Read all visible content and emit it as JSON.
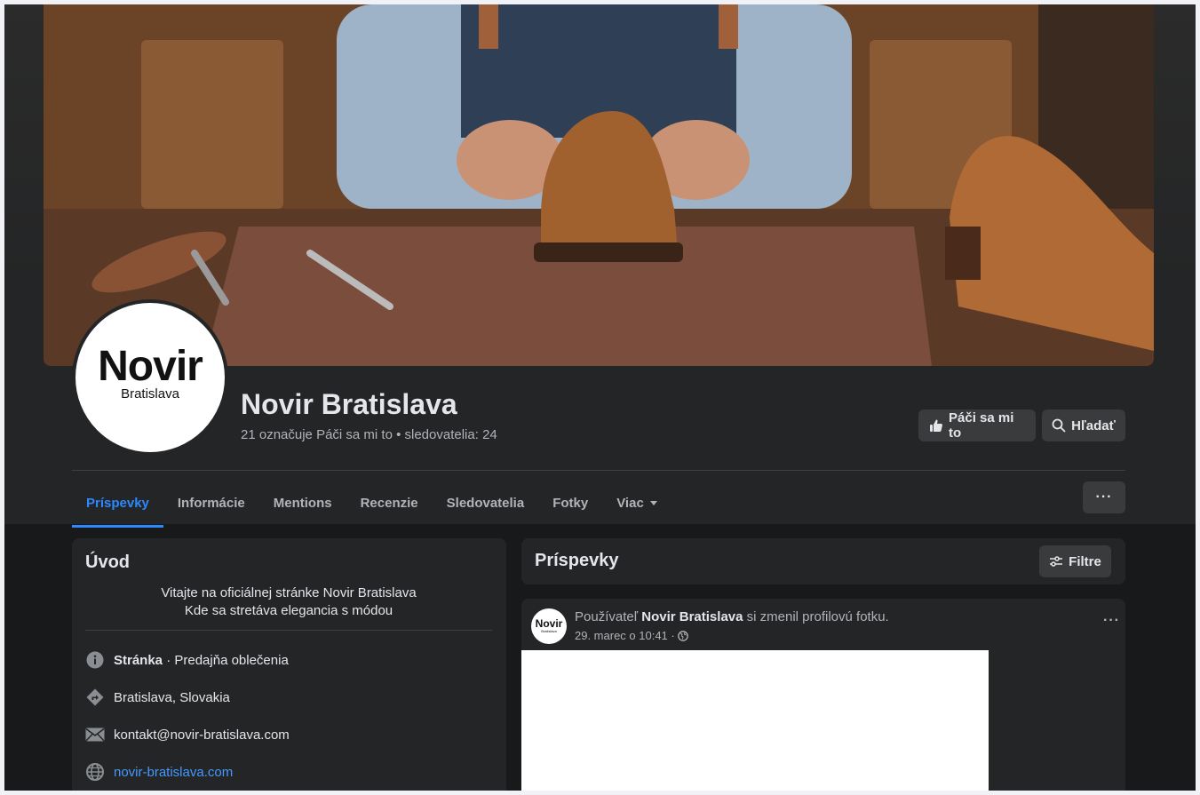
{
  "page": {
    "name": "Novir Bratislava",
    "stats": "21 označuje Páči sa mi to • sledovatelia: 24",
    "logo_big": "Novir",
    "logo_small": "Bratislava"
  },
  "actions": {
    "like_label": "Páči sa mi to",
    "search_label": "Hľadať",
    "more_label": "···"
  },
  "tabs": [
    {
      "label": "Príspevky",
      "active": true
    },
    {
      "label": "Informácie"
    },
    {
      "label": "Mentions"
    },
    {
      "label": "Recenzie"
    },
    {
      "label": "Sledovatelia"
    },
    {
      "label": "Fotky"
    },
    {
      "label": "Viac"
    }
  ],
  "intro": {
    "title": "Úvod",
    "line1": "Vitajte na oficiálnej stránke Novir Bratislava",
    "line2": "Kde sa stretáva elegancia s módou",
    "category_bold": "Stránka",
    "category_rest": " · Predajňa oblečenia",
    "location": "Bratislava, Slovakia",
    "email": "kontakt@novir-bratislava.com",
    "website": "novir-bratislava.com"
  },
  "posts": {
    "title": "Príspevky",
    "filter_label": "Filtre",
    "post": {
      "prefix": "Používateľ ",
      "author": "Novir Bratislava",
      "suffix": " si zmenil profilovú fotku.",
      "date": "29. marec o 10:41 ·",
      "more": "···",
      "avatar_l1": "Novir",
      "avatar_l2": "Bratislava"
    }
  },
  "colors": {
    "background": "#18191a",
    "card": "#242526",
    "accent": "#2d88ff",
    "link": "#4599ff"
  },
  "icons": [
    "thumbs-up-icon",
    "search-icon",
    "caret-down-icon",
    "info-icon",
    "directions-icon",
    "mail-icon",
    "globe-icon",
    "sliders-icon",
    "public-globe-icon"
  ]
}
